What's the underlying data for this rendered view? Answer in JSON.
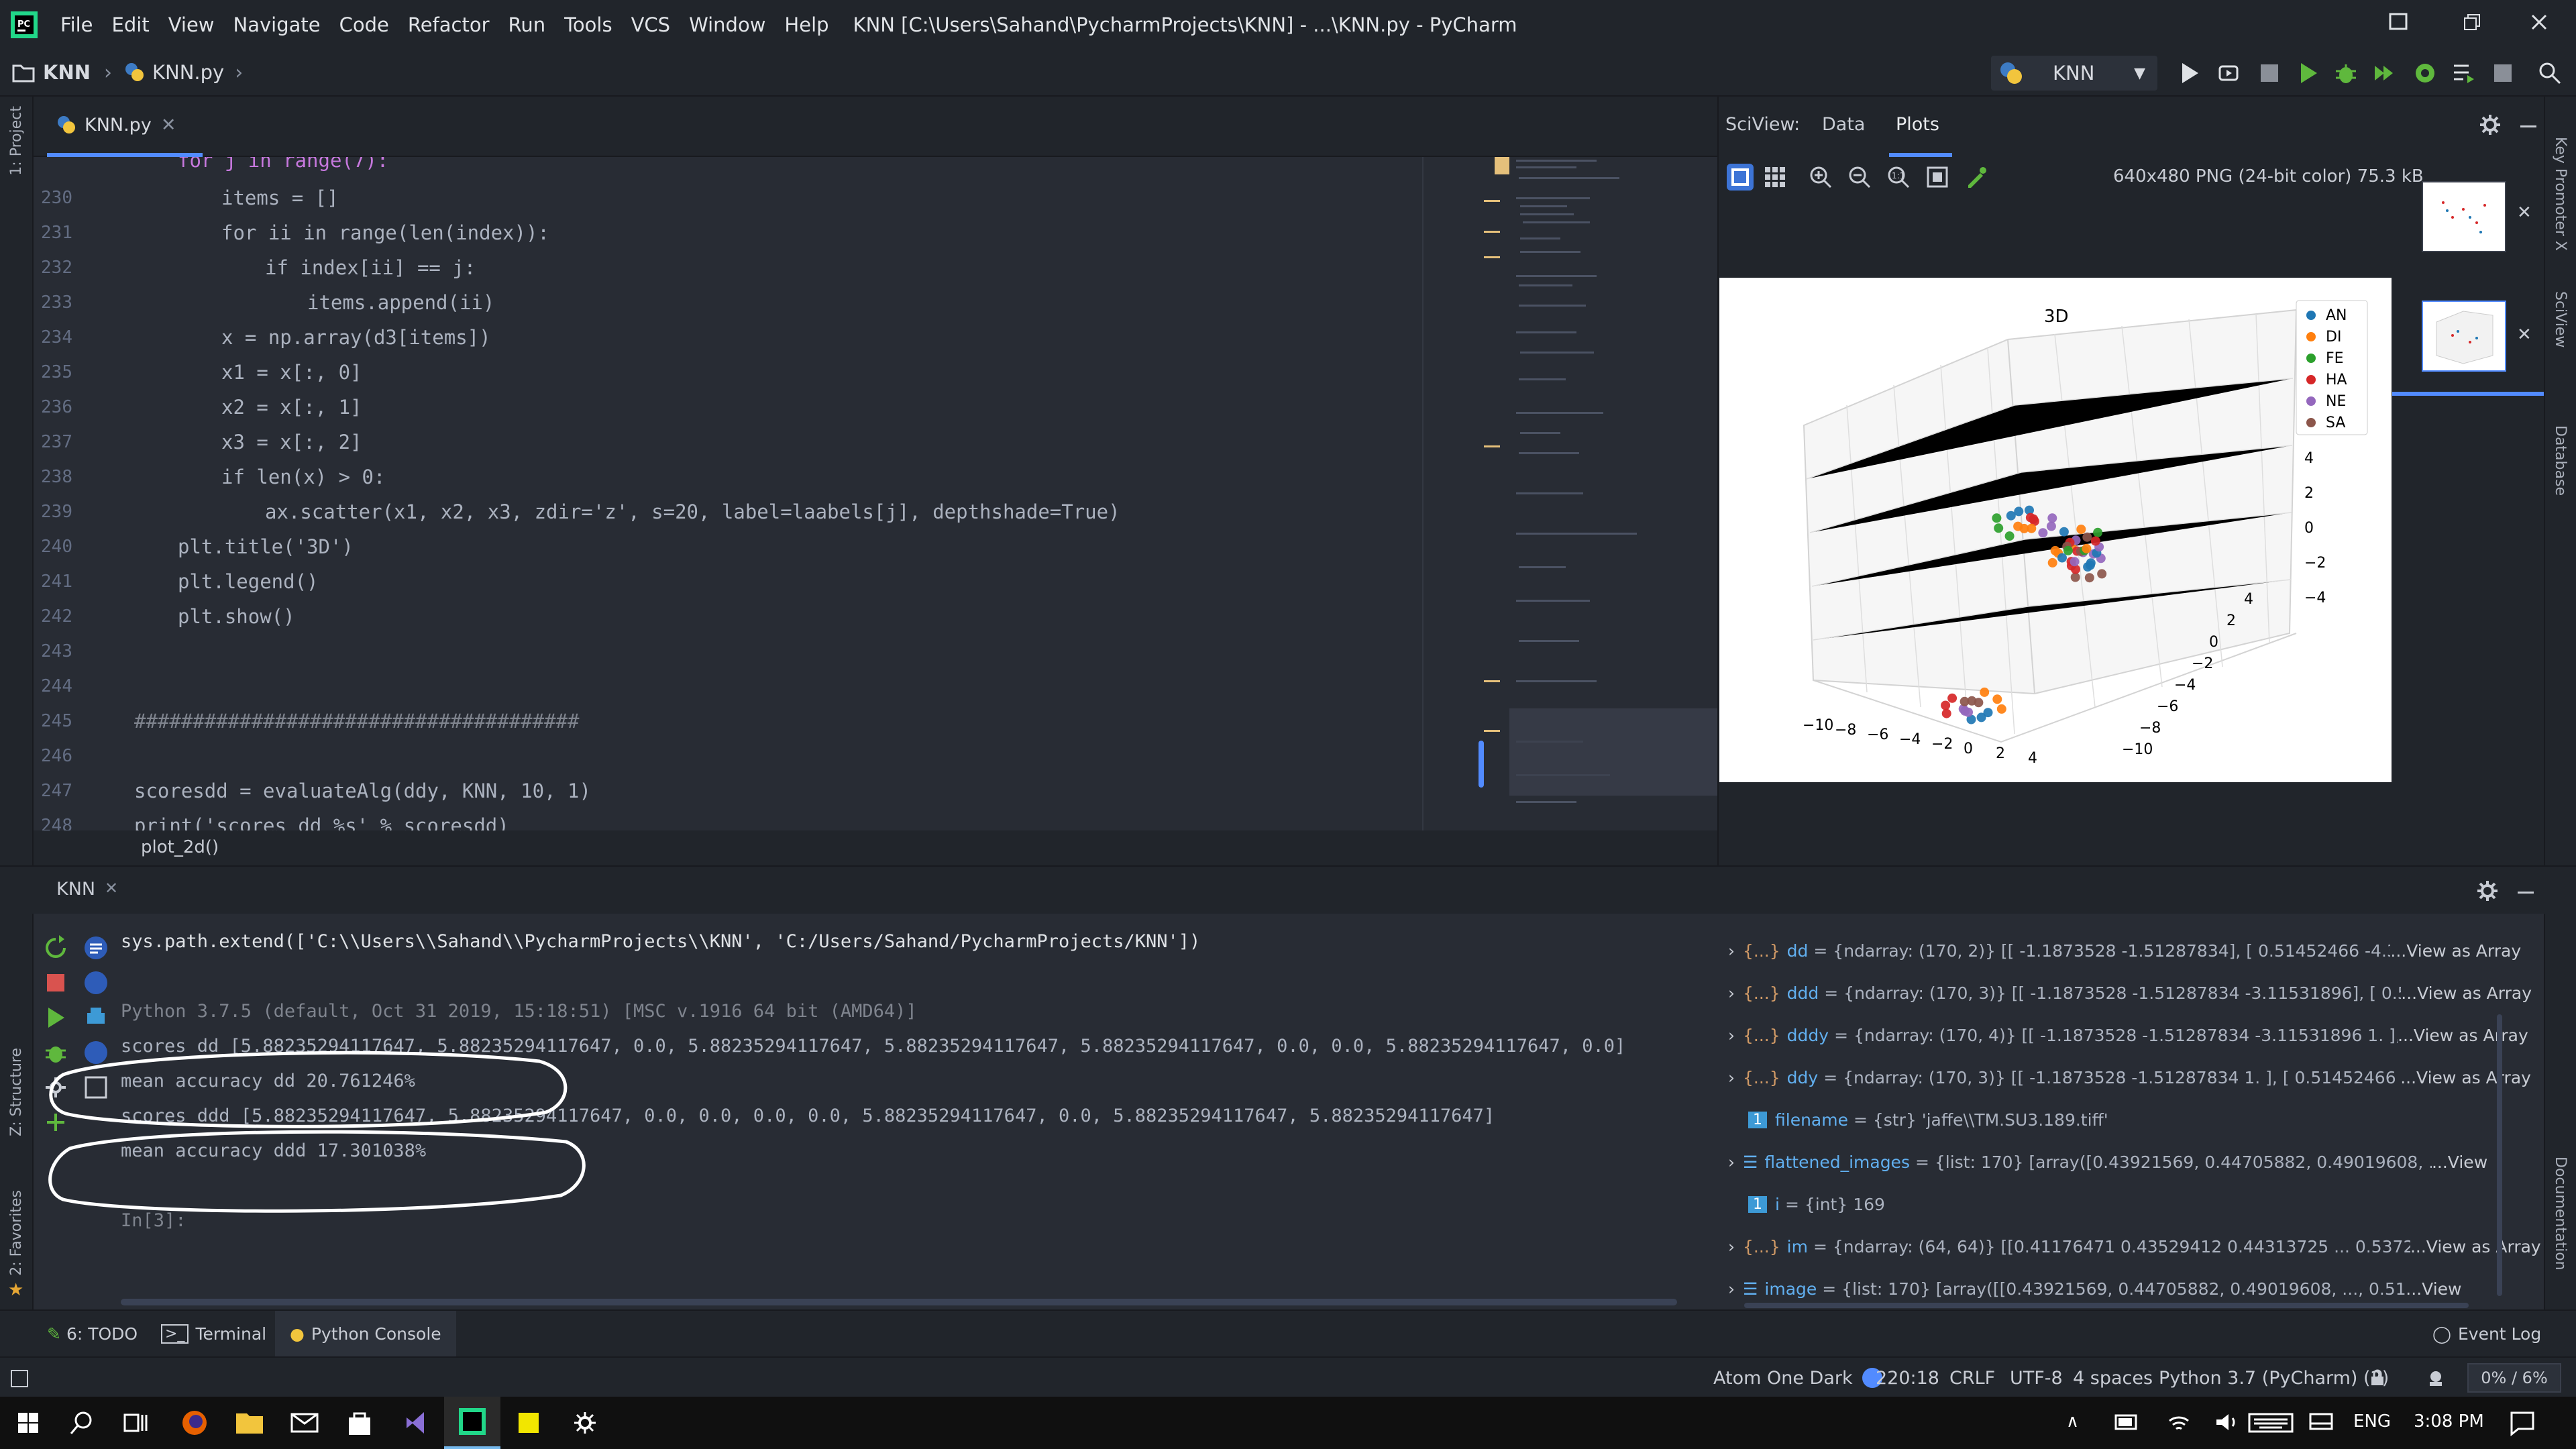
{
  "menubar": {
    "items": [
      "File",
      "Edit",
      "View",
      "Navigate",
      "Code",
      "Refactor",
      "Run",
      "Tools",
      "VCS",
      "Window",
      "Help"
    ],
    "title": "KNN [C:\\Users\\Sahand\\PycharmProjects\\KNN] - ...\\KNN.py - PyCharm"
  },
  "navbar": {
    "project": "KNN",
    "file": "KNN.py",
    "run_config": "KNN"
  },
  "left_strip": {
    "project": "1: Project",
    "structure": "Z: Structure",
    "favorites": "2: Favorites"
  },
  "right_strip": {
    "key_promoter": "Key Promoter X",
    "sciview": "SciView",
    "database": "Database",
    "documentation": "Documentation"
  },
  "editor": {
    "tab": "KNN.py",
    "partial_top": "for j in range(7):",
    "lines": [
      {
        "n": "230",
        "text": "items = []"
      },
      {
        "n": "231",
        "text": "for ii in range(len(index)):"
      },
      {
        "n": "232",
        "text": "if index[ii] == j:"
      },
      {
        "n": "233",
        "text": "items.append(ii)"
      },
      {
        "n": "234",
        "text": "x = np.array(d3[items])"
      },
      {
        "n": "235",
        "text": "x1 = x[:, 0]"
      },
      {
        "n": "236",
        "text": "x2 = x[:, 1]"
      },
      {
        "n": "237",
        "text": "x3 = x[:, 2]"
      },
      {
        "n": "238",
        "text": "if len(x) > 0:"
      },
      {
        "n": "239",
        "text": "ax.scatter(x1, x2, x3, zdir='z', s=20, label=laabels[j], depthshade=True)"
      },
      {
        "n": "240",
        "text": "plt.title('3D')"
      },
      {
        "n": "241",
        "text": "plt.legend()"
      },
      {
        "n": "242",
        "text": "plt.show()"
      },
      {
        "n": "243",
        "text": ""
      },
      {
        "n": "244",
        "text": ""
      },
      {
        "n": "245",
        "text": "######################################"
      },
      {
        "n": "246",
        "text": ""
      },
      {
        "n": "247",
        "text": "scoresdd = evaluateAlg(ddy, KNN, 10, 1)"
      },
      {
        "n": "248",
        "text": "print('scores dd %s' % scoresdd)"
      }
    ],
    "breadcrumb_footer": "plot_2d()"
  },
  "sciview": {
    "label": "SciView:",
    "tabs": [
      "Data",
      "Plots"
    ],
    "active_tab": "Plots",
    "image_info": "640x480 PNG (24-bit color) 75.3 kB"
  },
  "chart_data": {
    "type": "scatter",
    "title": "3D",
    "legend": [
      "AN",
      "DI",
      "FE",
      "HA",
      "NE",
      "SA"
    ],
    "legend_colors": [
      "#1f77b4",
      "#ff7f0e",
      "#2ca02c",
      "#d62728",
      "#9467bd",
      "#8c564b"
    ],
    "legend_position": "top-right",
    "x_ticks": [
      "−10",
      "−8",
      "−6",
      "−4",
      "−2",
      "0",
      "2",
      "4"
    ],
    "y_ticks": [
      "−10",
      "−8",
      "−6",
      "−4",
      "−2",
      "0",
      "2",
      "4"
    ],
    "z_ticks": [
      "4",
      "2",
      "0",
      "−2",
      "−4"
    ],
    "clusters": [
      {
        "x": -6.5,
        "y": 2.5,
        "z": 3.2,
        "series": [
          "HA",
          "DI",
          "AN",
          "NE",
          "FE"
        ]
      },
      {
        "x": 0.5,
        "y": -1.0,
        "z": -1.0,
        "series": [
          "AN",
          "HA",
          "NE",
          "SA",
          "DI"
        ]
      },
      {
        "x": 2.5,
        "y": -3.0,
        "z": -1.5,
        "series": [
          "HA",
          "NE",
          "AN",
          "DI",
          "FE",
          "SA"
        ]
      },
      {
        "x": -8.0,
        "y": 1.0,
        "z": -4.0,
        "series": [
          "NE",
          "SA",
          "AN",
          "HA",
          "DI"
        ]
      }
    ]
  },
  "run_panel": {
    "tab": "KNN"
  },
  "console": {
    "lines": [
      {
        "text": "sys.path.extend(['C:\\\\Users\\\\Sahand\\\\PycharmProjects\\\\KNN', 'C:/Users/Sahand/PycharmProjects/KNN'])",
        "kind": "code"
      },
      {
        "text": "",
        "kind": "blank"
      },
      {
        "text": "Python 3.7.5 (default, Oct 31 2019, 15:18:51) [MSC v.1916 64 bit (AMD64)]",
        "kind": "dim"
      },
      {
        "text": "scores dd [5.88235294117647, 5.88235294117647, 0.0, 5.88235294117647, 5.88235294117647, 5.88235294117647, 0.0, 0.0, 5.88235294117647, 0.0]",
        "kind": "out"
      },
      {
        "text": "mean accuracy dd 20.761246%",
        "kind": "out"
      },
      {
        "text": "scores ddd [5.88235294117647, 5.88235294117647, 0.0, 0.0, 0.0, 0.0, 5.88235294117647, 0.0, 5.88235294117647, 5.88235294117647]",
        "kind": "out"
      },
      {
        "text": "mean accuracy ddd 17.301038%",
        "kind": "out"
      },
      {
        "text": "",
        "kind": "blank"
      },
      {
        "text": "In[3]:",
        "kind": "prompt"
      }
    ]
  },
  "variables": [
    {
      "icon": "{...}",
      "name": "dd",
      "value": "= {ndarray: (170, 2)} [[ -1.1873528   -1.51287834], [  0.51452466  -4.32573",
      "link": "...View as Array",
      "expandable": true
    },
    {
      "icon": "{...}",
      "name": "ddd",
      "value": "= {ndarray: (170, 3)} [[ -1.1873528   -1.51287834  -3.11531896], [  0.5145",
      "link": "...View as Array",
      "expandable": true
    },
    {
      "icon": "{...}",
      "name": "dddy",
      "value": "= {ndarray: (170, 4)} [[ -1.1873528   -1.51287834  -3.11531896   1.          ], [",
      "link": "...View as Array",
      "expandable": true
    },
    {
      "icon": "{...}",
      "name": "ddy",
      "value": "= {ndarray: (170, 3)} [[ -1.1873528   -1.51287834   1.          ], [  0.51452466",
      "link": "...View as Array",
      "expandable": true
    },
    {
      "icon": "1",
      "name": "filename",
      "value": "= {str} 'jaffe\\\\TM.SU3.189.tiff'",
      "link": "",
      "expandable": false
    },
    {
      "icon": "list",
      "name": "flattened_images",
      "value": "= {list: 170} [array([0.43921569, 0.44705882, 0.49019608, ..., 0.4196",
      "link": "...View",
      "expandable": true
    },
    {
      "icon": "1",
      "name": "i",
      "value": "= {int} 169",
      "link": "",
      "expandable": false
    },
    {
      "icon": "{...}",
      "name": "im",
      "value": "= {ndarray: (64, 64)} [[0.41176471 0.43529412 0.44313725 ... 0.5372549  0.",
      "link": "...View as Array",
      "expandable": true
    },
    {
      "icon": "list",
      "name": "image",
      "value": "= {list: 170} [array([[0.43921569, 0.44705882, 0.49019608, ..., 0.51372549, 0.53",
      "link": "...View",
      "expandable": true
    }
  ],
  "toolwindows": {
    "todo": "6: TODO",
    "terminal": "Terminal",
    "python_console": "Python Console",
    "event_log": "Event Log"
  },
  "statusbar": {
    "theme": "Atom One Dark",
    "position": "220:18",
    "line_sep": "CRLF",
    "encoding": "UTF-8",
    "indent": "4 spaces",
    "interpreter": "Python 3.7 (PyCharm) (2)",
    "memory": "0% / 6%"
  },
  "taskbar": {
    "lang": "ENG",
    "time": "3:08 PM"
  }
}
